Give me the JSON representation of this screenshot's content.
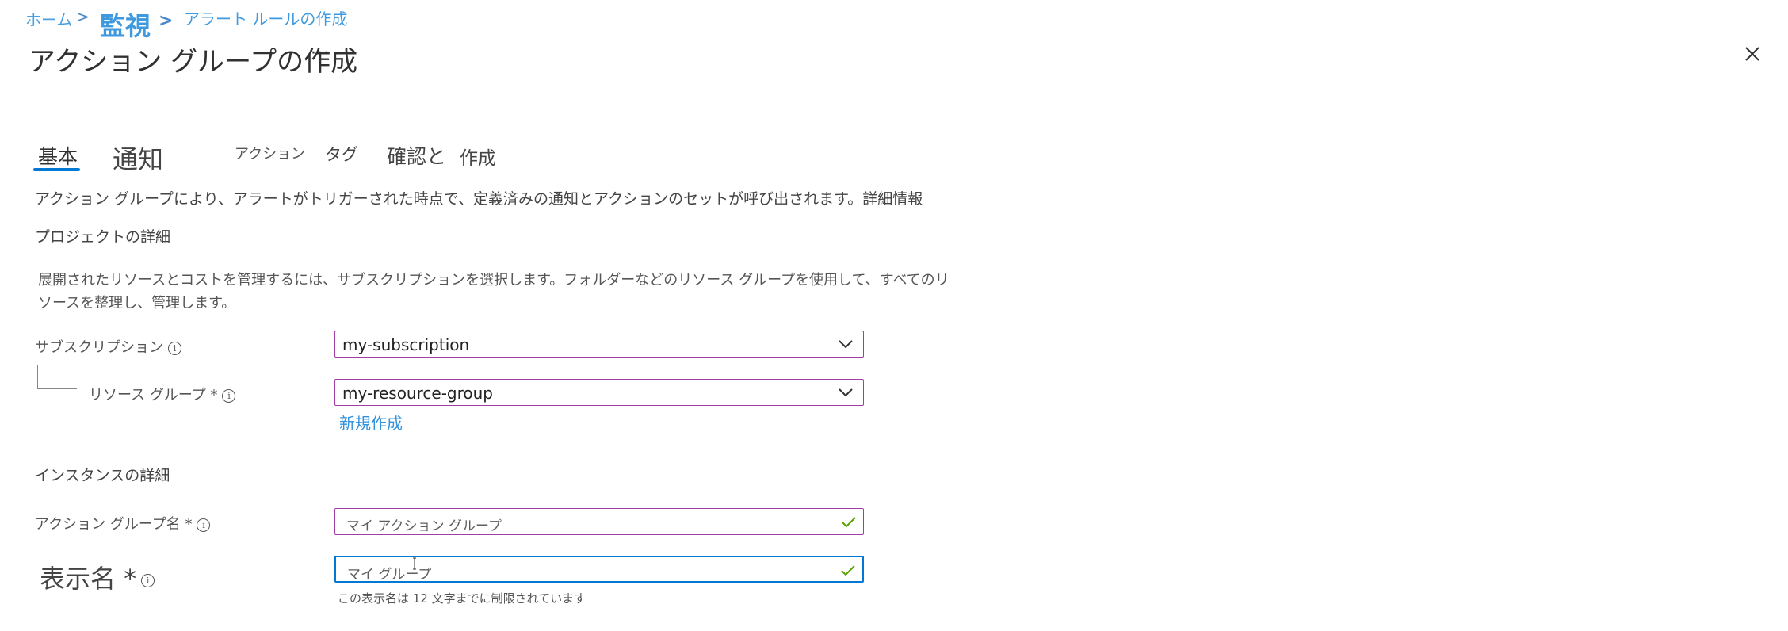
{
  "breadcrumb": {
    "home": "ホーム",
    "sep": ">",
    "monitor": "監視",
    "alert_rule": "アラート ルールの作成"
  },
  "header": {
    "title": "アクション グループの作成",
    "more": "···",
    "close_icon": "close-icon"
  },
  "tabs": [
    {
      "label": "基本",
      "active": true
    },
    {
      "label": "通知"
    },
    {
      "label": "アクション"
    },
    {
      "label": "タグ"
    },
    {
      "label": "確認と"
    },
    {
      "label": "作成"
    }
  ],
  "main": {
    "description": "アクション グループにより、アラートがトリガーされた時点で、定義済みの通知とアクションのセットが呼び出されます。詳細情報",
    "project_section": "プロジェクトの詳細",
    "project_paragraph": "展開されたリソースとコストを管理するには、サブスクリプションを選択します。フォルダーなどのリソース グループを使用して、すべてのリソースを整理し、管理します。",
    "subscription": {
      "label": "サブスクリプション",
      "value": "my-subscription"
    },
    "resource_group": {
      "label": "リソース グループ *",
      "value": "my-resource-group",
      "new_link": "新規作成"
    },
    "instance_section": "インスタンスの詳細",
    "action_group_name": {
      "label": "アクション グループ名 *",
      "placeholder": "マイ アクション グループ"
    },
    "display_name": {
      "label": "表示名 *",
      "placeholder": "マイ グループ",
      "hint": "この表示名は 12 文字までに制限されています"
    }
  },
  "colors": {
    "accent": "#0078d4",
    "field_border": "#a33ca3",
    "valid_check": "#57a300"
  }
}
